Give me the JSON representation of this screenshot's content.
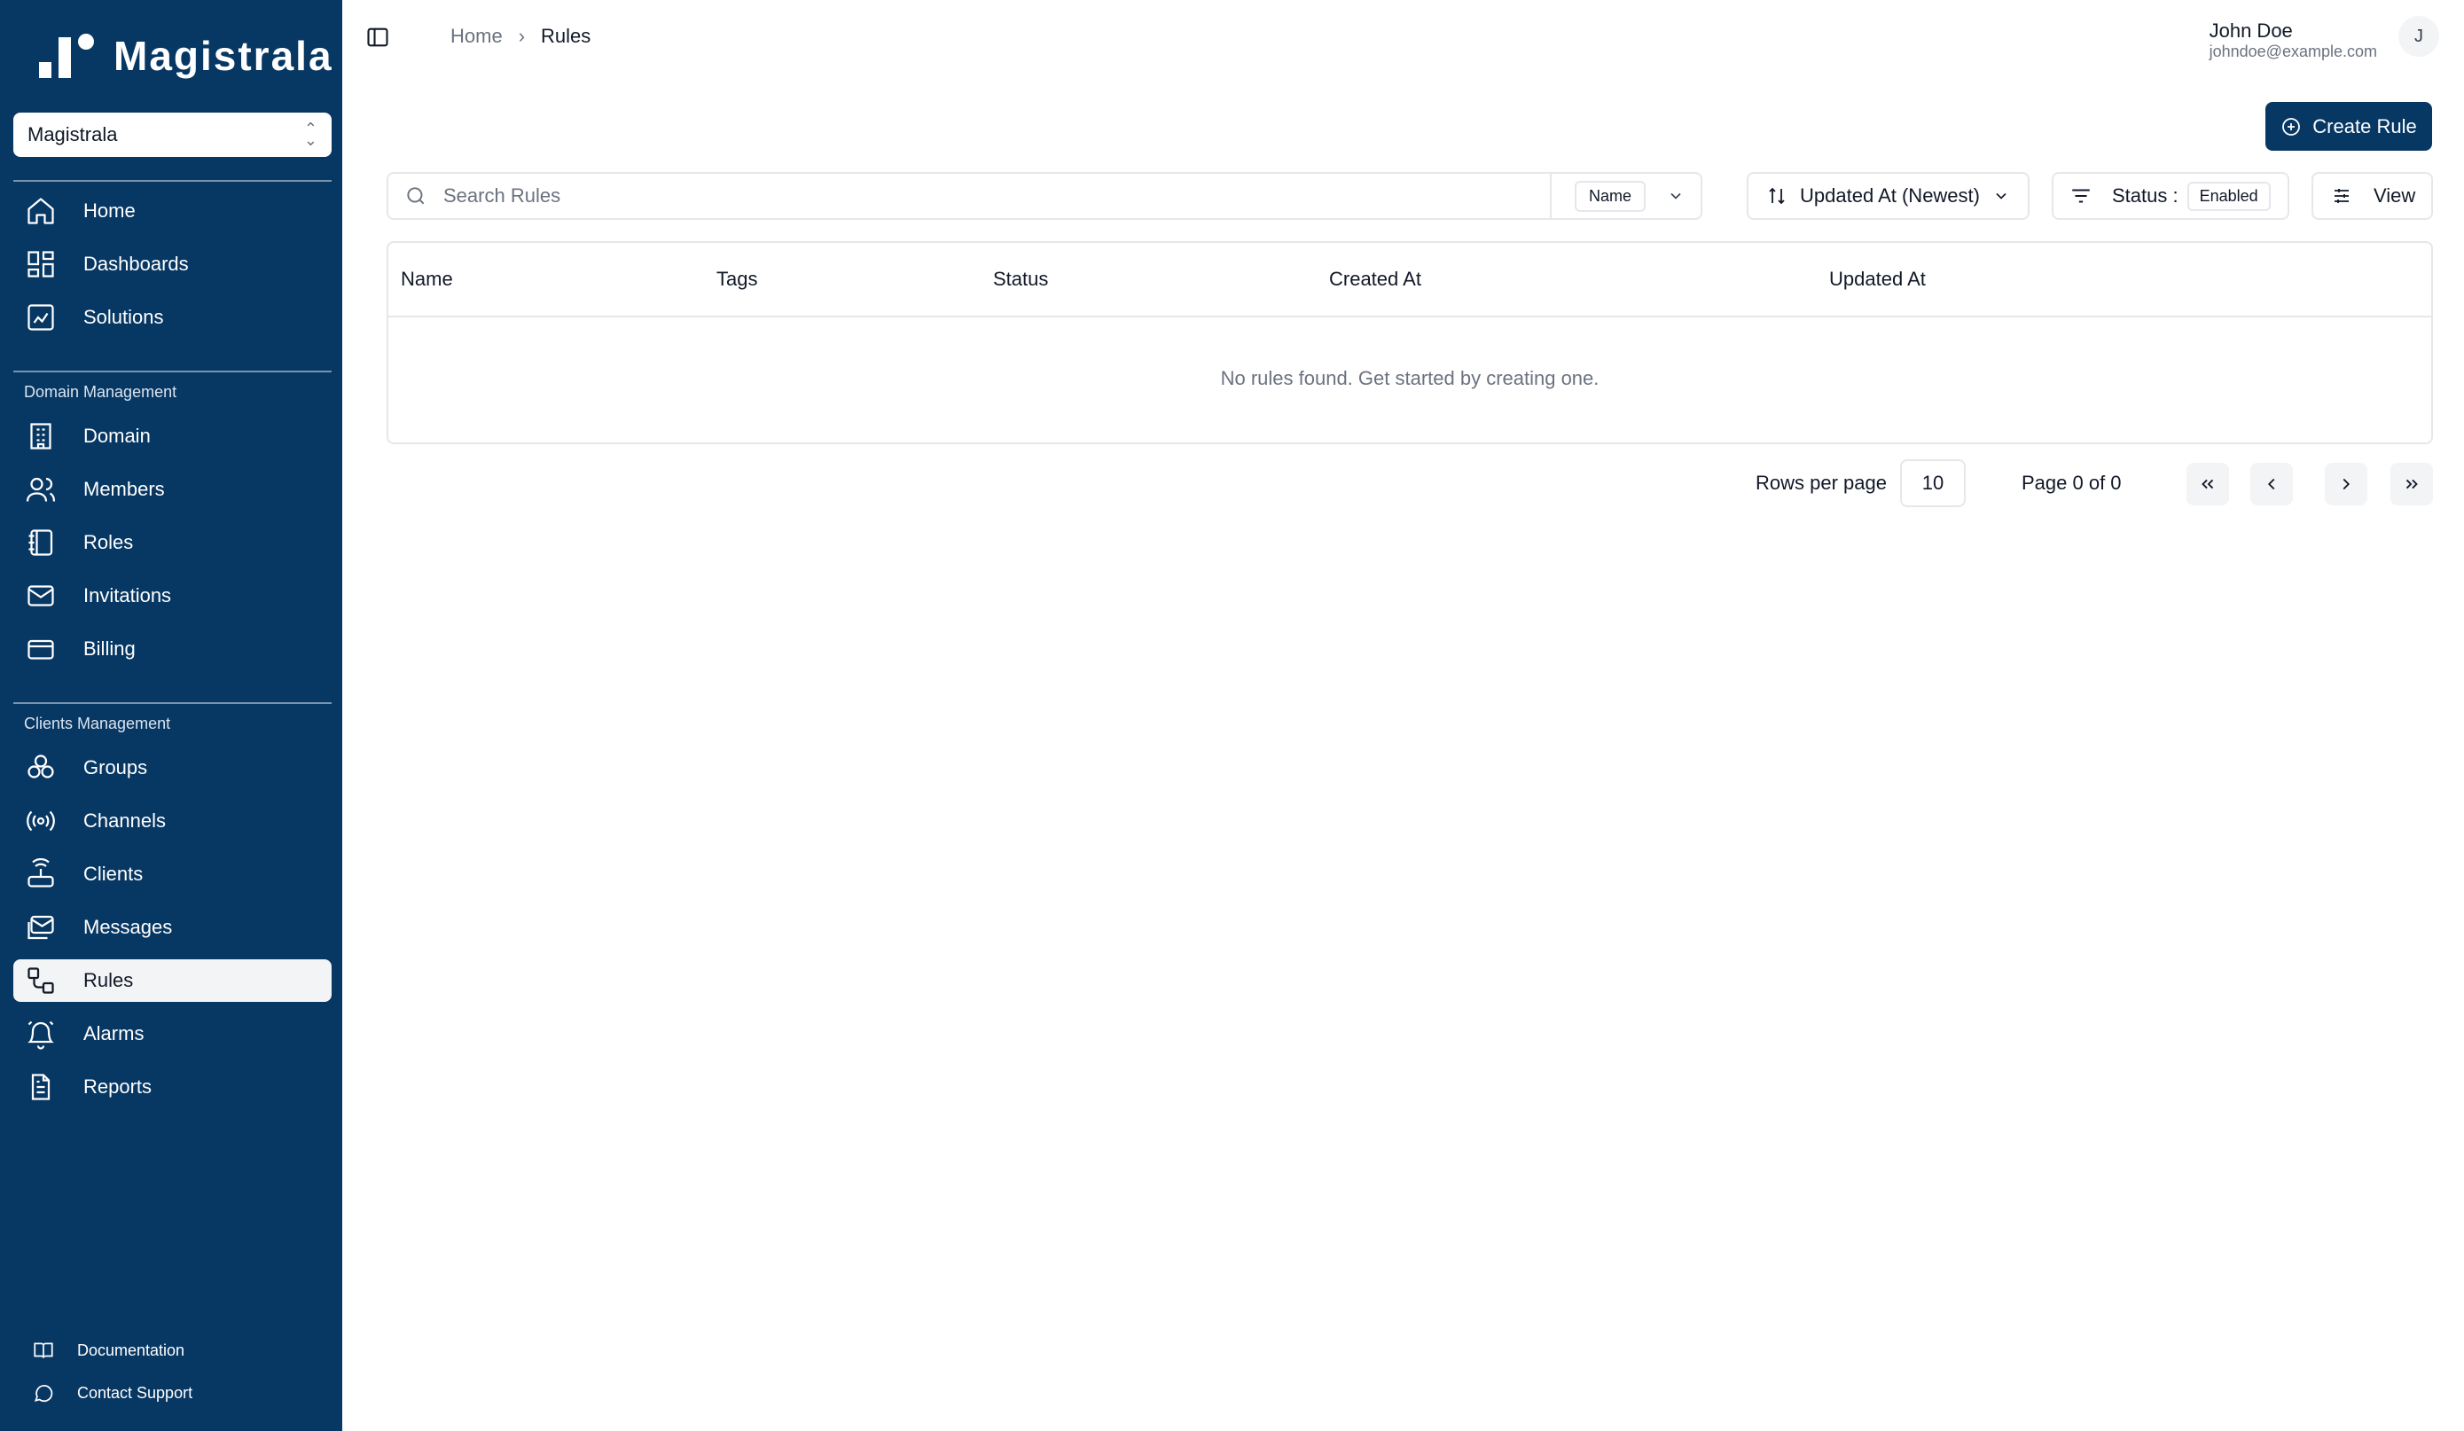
{
  "app": {
    "logo_text": "Magistrala"
  },
  "sidebar": {
    "domain_select": "Magistrala",
    "top_items": [
      {
        "label": "Home",
        "icon": "home-icon"
      },
      {
        "label": "Dashboards",
        "icon": "dashboard-icon"
      },
      {
        "label": "Solutions",
        "icon": "solutions-icon"
      }
    ],
    "domain_section_label": "Domain Management",
    "domain_items": [
      {
        "label": "Domain",
        "icon": "building-icon"
      },
      {
        "label": "Members",
        "icon": "users-icon"
      },
      {
        "label": "Roles",
        "icon": "roles-icon"
      },
      {
        "label": "Invitations",
        "icon": "mail-icon"
      },
      {
        "label": "Billing",
        "icon": "credit-card-icon"
      }
    ],
    "clients_section_label": "Clients Management",
    "clients_items": [
      {
        "label": "Groups",
        "icon": "groups-icon"
      },
      {
        "label": "Channels",
        "icon": "radio-icon"
      },
      {
        "label": "Clients",
        "icon": "router-icon"
      },
      {
        "label": "Messages",
        "icon": "messages-icon"
      },
      {
        "label": "Rules",
        "icon": "workflow-icon",
        "active": true
      },
      {
        "label": "Alarms",
        "icon": "bell-icon"
      },
      {
        "label": "Reports",
        "icon": "file-icon"
      }
    ],
    "footer": [
      {
        "label": "Documentation",
        "icon": "book-icon"
      },
      {
        "label": "Contact Support",
        "icon": "chat-icon"
      }
    ]
  },
  "header": {
    "breadcrumb": {
      "home": "Home",
      "separator": "›",
      "current": "Rules"
    },
    "user": {
      "name": "John Doe",
      "email": "johndoe@example.com",
      "avatar_initial": "J"
    }
  },
  "main": {
    "create_label": "Create Rule",
    "search": {
      "placeholder": "Search Rules",
      "field": "Name"
    },
    "sort_label": "Updated At (Newest)",
    "status": {
      "label": "Status :",
      "value": "Enabled"
    },
    "view_label": "View",
    "table": {
      "columns": [
        "Name",
        "Tags",
        "Status",
        "Created At",
        "Updated At"
      ],
      "empty_message": "No rules found. Get started by creating one."
    },
    "pagination": {
      "rows_label": "Rows per page",
      "rows_value": "10",
      "page_info": "Page 0 of 0"
    }
  },
  "colors": {
    "sidebar_bg": "#073763",
    "primary": "#073763",
    "border": "#e5e7eb",
    "muted": "#6b7280"
  }
}
